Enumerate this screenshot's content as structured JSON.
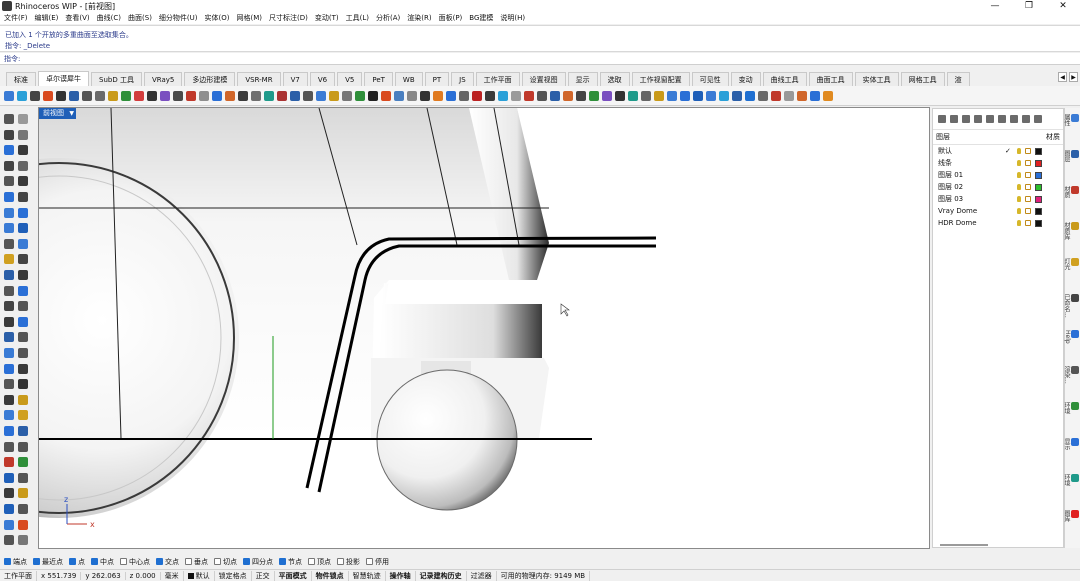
{
  "window": {
    "title": "Rhinoceros WIP - [前视图]",
    "controls": [
      "—",
      "❐",
      "✕"
    ]
  },
  "menu": [
    "文件(F)",
    "编辑(E)",
    "查看(V)",
    "曲线(C)",
    "曲面(S)",
    "细分物件(U)",
    "实体(O)",
    "网格(M)",
    "尺寸标注(D)",
    "变动(T)",
    "工具(L)",
    "分析(A)",
    "渲染(R)",
    "面板(P)",
    "BG建模",
    "说明(H)"
  ],
  "history": {
    "line1": "已加入 1 个开放的多重曲面至选取集合。",
    "line2": "指令: _Delete"
  },
  "command": {
    "prompt": "指令:",
    "value": ""
  },
  "tabs": [
    "标准",
    "卓尔谟犀牛",
    "SubD 工具",
    "VRay5",
    "多边形建模",
    "VSR-MR",
    "V7",
    "V6",
    "V5",
    "PeT",
    "WB",
    "PT",
    "JS",
    "工作平面",
    "设置视图",
    "显示",
    "选取",
    "工作视窗配置",
    "可见性",
    "变动",
    "曲线工具",
    "曲面工具",
    "实体工具",
    "网格工具",
    "渲"
  ],
  "active_tab_index": 1,
  "viewport": {
    "title": "前视图",
    "axis_x": "x",
    "axis_y": "z"
  },
  "layers_panel": {
    "header_left": "图层",
    "header_right": "材质",
    "layers": [
      {
        "name": "默认",
        "current": "✓",
        "color": "#111111"
      },
      {
        "name": "线条",
        "current": "",
        "color": "#e02020"
      },
      {
        "name": "图层 01",
        "current": "",
        "color": "#2a6fd6"
      },
      {
        "name": "图层 02",
        "current": "",
        "color": "#2bbf2b"
      },
      {
        "name": "图层 03",
        "current": "",
        "color": "#e0207a"
      },
      {
        "name": "Vray Dome",
        "current": "",
        "color": "#111111"
      },
      {
        "name": "HDR Dome",
        "current": "",
        "color": "#111111"
      }
    ]
  },
  "side_tabs": [
    "属性",
    "图层",
    "材质",
    "材质库",
    "灯光",
    "已命名...",
    "Help",
    "渲染...",
    "环境",
    "显示",
    "环境",
    "图库"
  ],
  "osnap": [
    {
      "label": "端点",
      "on": true
    },
    {
      "label": "最近点",
      "on": true
    },
    {
      "label": "点",
      "on": true
    },
    {
      "label": "中点",
      "on": true
    },
    {
      "label": "中心点",
      "on": false
    },
    {
      "label": "交点",
      "on": true
    },
    {
      "label": "垂点",
      "on": false
    },
    {
      "label": "切点",
      "on": false
    },
    {
      "label": "四分点",
      "on": true
    },
    {
      "label": "节点",
      "on": true
    },
    {
      "label": "顶点",
      "on": false
    },
    {
      "label": "投影",
      "on": false
    },
    {
      "label": "停用",
      "on": false
    }
  ],
  "status": {
    "cplane": "工作平面",
    "x": "x 551.739",
    "y": "y 262.063",
    "z": "z 0.000",
    "units": "毫米",
    "layer": "默认",
    "items": [
      "锁定格点",
      "正交",
      "平面模式",
      "物件锁点",
      "智慧轨迹",
      "操作轴",
      "记录建构历史",
      "过滤器"
    ],
    "bold_items": [
      "平面模式",
      "物件锁点",
      "操作轴",
      "记录建构历史"
    ],
    "memory": "可用的物理内存: 9149 MB"
  }
}
